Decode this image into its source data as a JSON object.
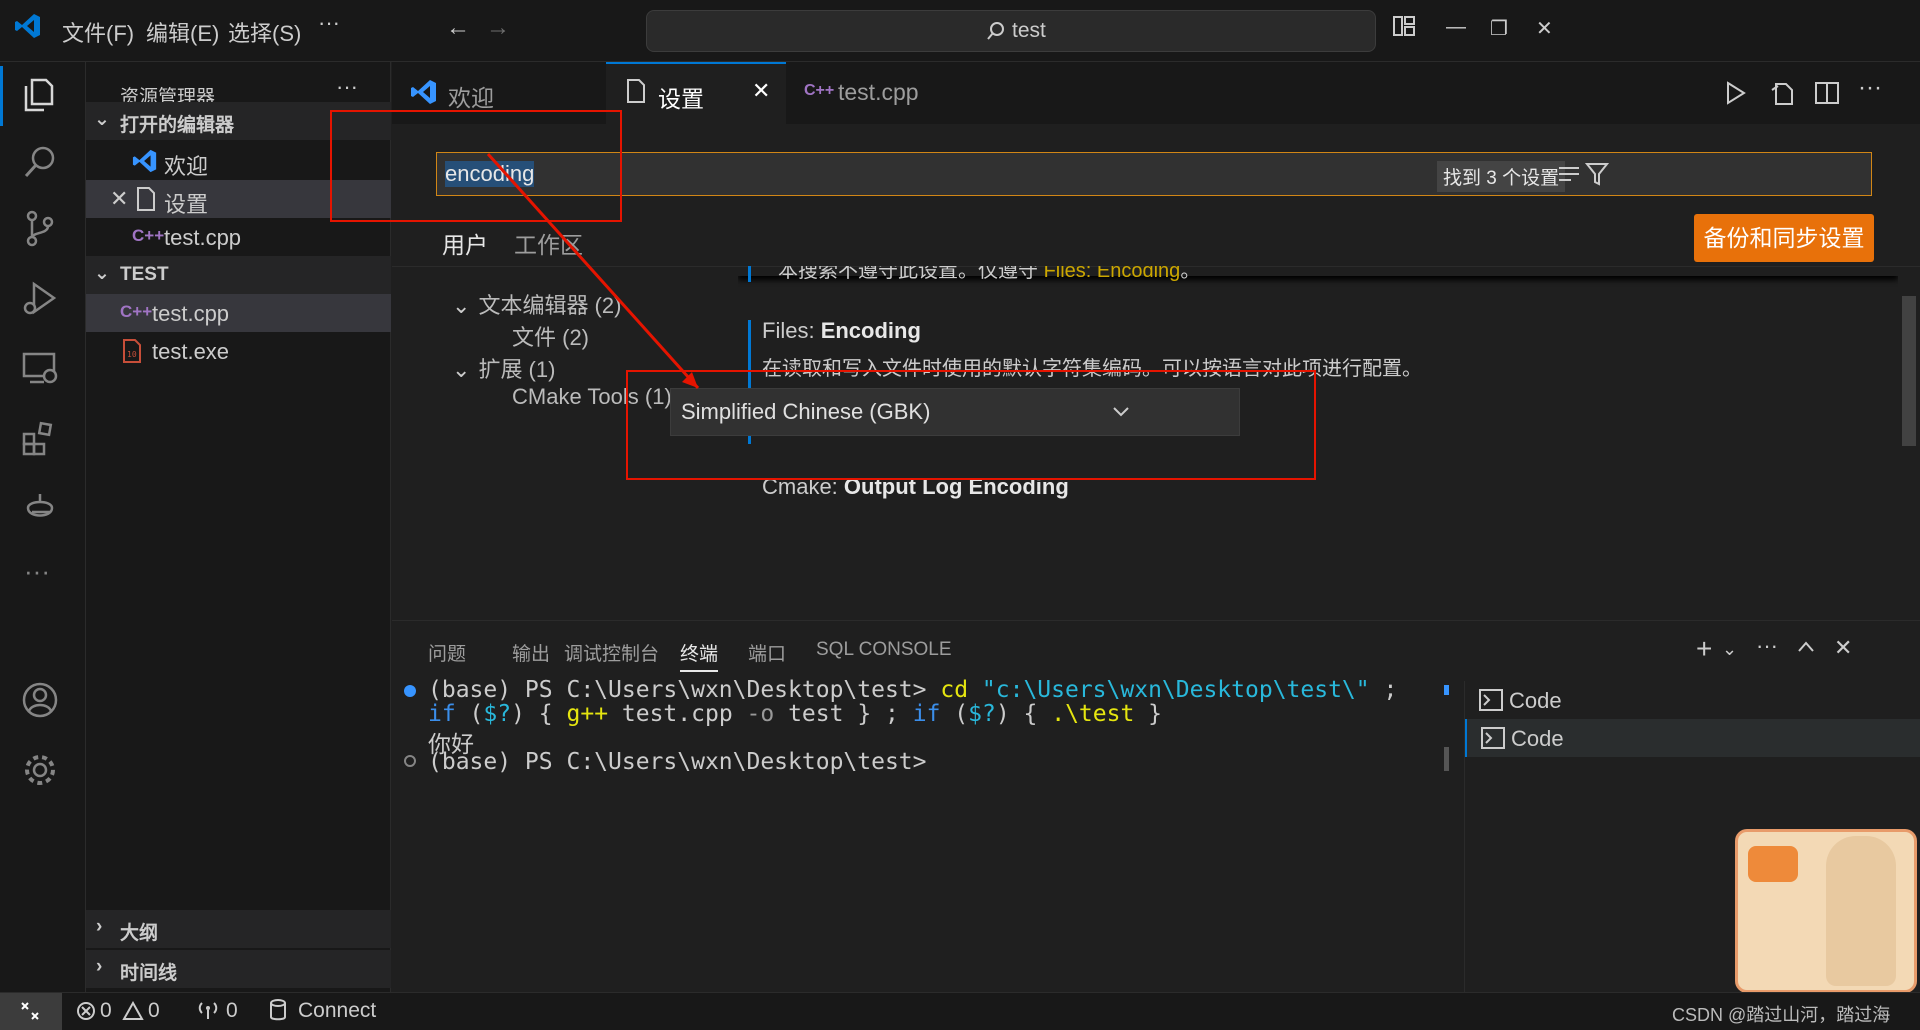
{
  "titlebar": {
    "menu": [
      "文件(F)",
      "编辑(E)",
      "选择(S)"
    ],
    "more": "···",
    "search_text": "test"
  },
  "sidebar": {
    "title": "资源管理器",
    "more": "···",
    "open_editors_header": "打开的编辑器",
    "open_editors": [
      "欢迎",
      "设置",
      "test.cpp"
    ],
    "folder_header": "TEST",
    "files": [
      "test.cpp",
      "test.exe"
    ],
    "outline": "大纲",
    "timeline": "时间线"
  },
  "tabs": {
    "welcome": "欢迎",
    "settings": "设置",
    "testcpp": "test.cpp"
  },
  "settings": {
    "search_value": "encoding",
    "found_badge": "找到 3 个设置",
    "sync_button": "备份和同步设置",
    "scope_tabs": [
      "用户",
      "工作区"
    ],
    "toc": [
      "文本编辑器 (2)",
      "文件 (2)",
      "扩展 (1)",
      "CMake Tools (1)"
    ],
    "cut_text": "本搜索不遵守此设置。仅遵守",
    "cut_link": "Files: Encoding",
    "cut_end": "。",
    "files_encoding_prefix": "Files:",
    "files_encoding_name": "Encoding",
    "files_encoding_desc": "在读取和写入文件时使用的默认字符集编码。可以按语言对此项进行配置。",
    "files_encoding_value": "Simplified Chinese (GBK)",
    "cmake_prefix": "Cmake:",
    "cmake_name": "Output Log Encoding"
  },
  "panel": {
    "tabs": [
      "问题",
      "输出",
      "调试控制台",
      "终端",
      "端口",
      "SQL CONSOLE"
    ],
    "active_tab": "终端",
    "terminal_lines": {
      "l1a": "(base) PS C:\\Users\\wxn\\Desktop\\test> ",
      "l1b": "cd ",
      "l1c": "\"c:\\Users\\wxn\\Desktop\\test\\\"",
      "l1d": " ;",
      "l2a": "if",
      "l2b": " (",
      "l2c": "$?",
      "l2d": ") { ",
      "l2e": "g++",
      "l2f": " test.cpp ",
      "l2g": "-o",
      "l2h": " test } ; ",
      "l2i": "if",
      "l2j": " (",
      "l2k": "$?",
      "l2l": ") { ",
      "l2m": ".\\test",
      "l2n": " }",
      "l3": "你好",
      "l4": "(base) PS C:\\Users\\wxn\\Desktop\\test>"
    },
    "terminal_instances": [
      "Code",
      "Code"
    ]
  },
  "statusbar": {
    "errors": "0",
    "warnings": "0",
    "ports": "0",
    "connect": "Connect",
    "watermark": "CSDN @踏过山河，踏过海"
  },
  "colors": {
    "accent": "#0078d4",
    "sync_button": "#e8710a",
    "search_border": "#d18616",
    "annotation_red": "#e51400",
    "link_yellow": "#cca700"
  }
}
